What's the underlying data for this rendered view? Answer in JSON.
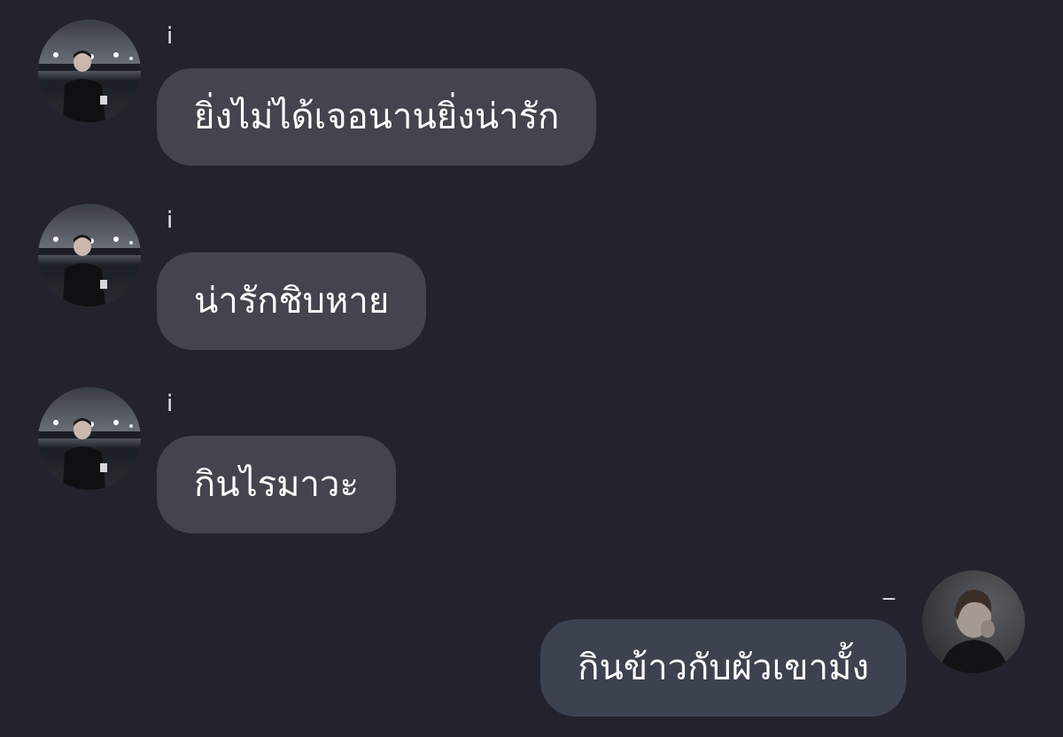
{
  "chat": {
    "messages": [
      {
        "direction": "incoming",
        "sender": "i",
        "text": "ยิ่งไม่ได้เจอนานยิ่งน่ารัก",
        "avatar_icon": "avatar-night-street-photo"
      },
      {
        "direction": "incoming",
        "sender": "i",
        "text": "น่ารักชิบหาย",
        "avatar_icon": "avatar-night-street-photo"
      },
      {
        "direction": "incoming",
        "sender": "i",
        "text": "กินไรมาวะ",
        "avatar_icon": "avatar-night-street-photo"
      },
      {
        "direction": "outgoing",
        "sender": "_",
        "text": "กินข้าวกับผัวเขามั้ง",
        "avatar_icon": "avatar-dark-portrait-photo"
      }
    ]
  },
  "colors": {
    "background": "#24232d",
    "incoming_bubble": "#44434e",
    "outgoing_bubble": "#3d4250",
    "text": "#ffffff"
  }
}
